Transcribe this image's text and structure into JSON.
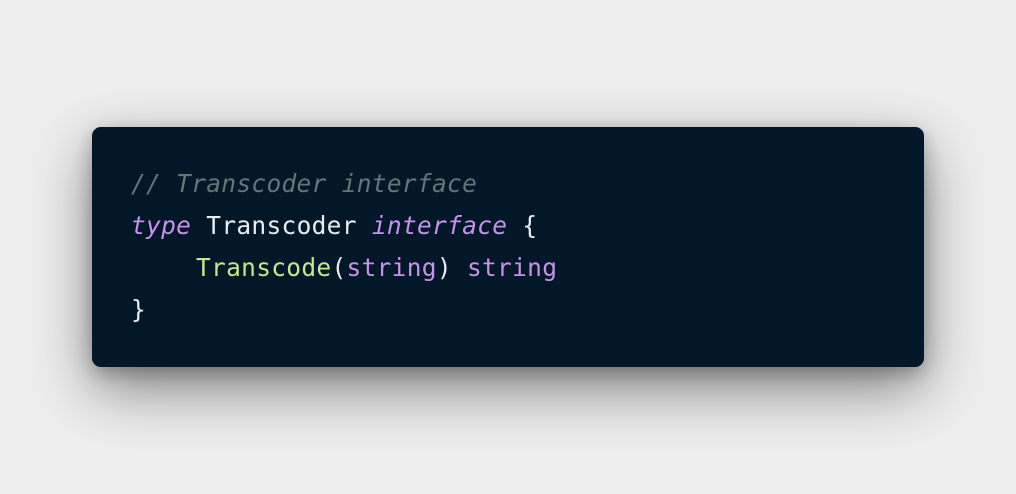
{
  "code": {
    "line1": {
      "comment": "// Transcoder interface"
    },
    "line2": {
      "keyword_type": "type",
      "name": "Transcoder",
      "keyword_interface": "interface",
      "open_brace": "{"
    },
    "line3": {
      "method": "Transcode",
      "paren_open": "(",
      "param_type": "string",
      "paren_close": ")",
      "return_type": "string"
    },
    "line4": {
      "close_brace": "}"
    }
  },
  "colors": {
    "background": "#eeeeee",
    "editor_background": "#021727",
    "comment": "#637777",
    "keyword": "#c792ea",
    "function": "#c3e88d",
    "text": "#e6edf3"
  }
}
